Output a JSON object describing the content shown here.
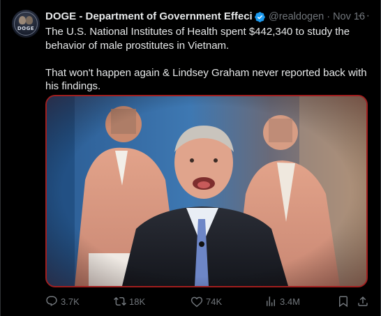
{
  "author": {
    "name": "DOGE - Department of Government Effecienc",
    "handle": "@realdogen",
    "date": "Nov 16",
    "avatar_text": "DOGE",
    "verified_color": "#1d9bf0"
  },
  "more_label": "···",
  "separator": "·",
  "tweet": {
    "paragraph1": "The U.S. National Institutes of Health spent $442,340 to study the behavior of male prostitutes in Vietnam.",
    "paragraph2": "That won't happen again & Lindsey Graham never reported back with his findings."
  },
  "actions": {
    "reply_count": "3.7K",
    "repost_count": "18K",
    "like_count": "74K",
    "views_count": "3.4M"
  },
  "icons": {
    "verified": "verified-badge-icon",
    "more": "more-options-icon",
    "reply": "reply-icon",
    "repost": "repost-icon",
    "like": "heart-icon",
    "views": "views-chart-icon",
    "bookmark": "bookmark-icon",
    "share": "share-icon"
  },
  "colors": {
    "background": "#000000",
    "text": "#e7e9ea",
    "muted": "#71767b",
    "media_border": "#a11e1e"
  }
}
